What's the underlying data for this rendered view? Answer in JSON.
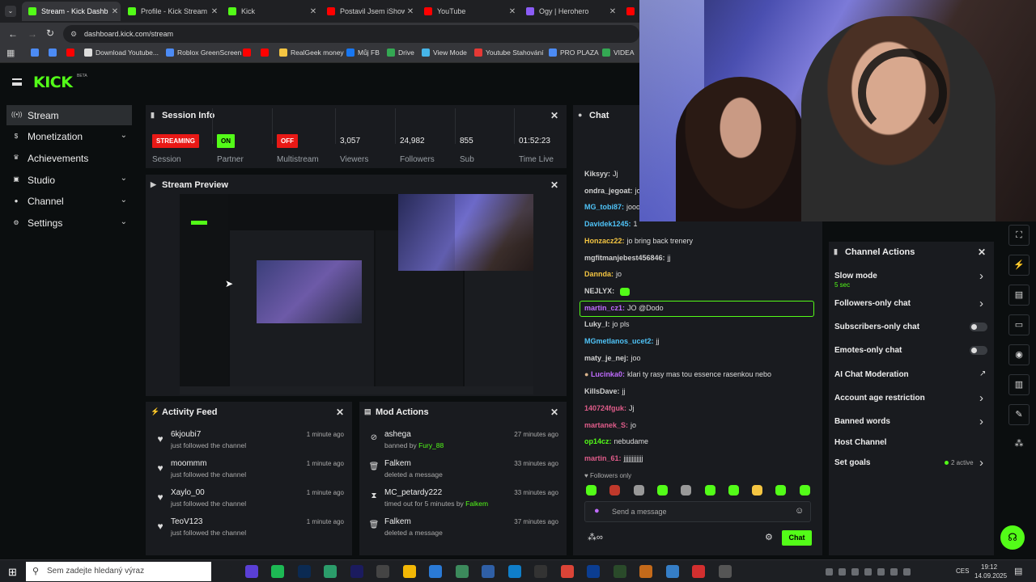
{
  "browser": {
    "tabs": [
      {
        "label": "Stream - Kick Dashb",
        "color": "#53fc18",
        "active": true
      },
      {
        "label": "Profile - Kick Stream",
        "color": "#53fc18"
      },
      {
        "label": "Kick",
        "color": "#53fc18"
      },
      {
        "label": "Postavil Jsem iShowS",
        "color": "#ff0000"
      },
      {
        "label": "YouTube",
        "color": "#ff0000"
      },
      {
        "label": "Ogy | Herohero",
        "color": "#8b5cf6"
      },
      {
        "label": "G",
        "color": "#ff0000"
      }
    ],
    "url": "dashboard.kick.com/stream",
    "bookmarks": [
      {
        "label": "",
        "color": "#4c8bf5"
      },
      {
        "label": "",
        "color": "#4c8bf5"
      },
      {
        "label": "",
        "color": "#ff0000"
      },
      {
        "label": "Download Youtube...",
        "color": "#ddd"
      },
      {
        "label": "Roblox GreenScreen",
        "color": "#4c8bf5"
      },
      {
        "label": "",
        "color": "#ff0000"
      },
      {
        "label": "",
        "color": "#ff0000"
      },
      {
        "label": "RealGeek money",
        "color": "#f4c542"
      },
      {
        "label": "Můj FB",
        "color": "#1877f2"
      },
      {
        "label": "Drive",
        "color": "#34a853"
      },
      {
        "label": "View Mode",
        "color": "#46b5e8"
      },
      {
        "label": "Youtube Stahování",
        "color": "#e53935"
      },
      {
        "label": "PRO PLAZA",
        "color": "#4c8bf5"
      },
      {
        "label": "VIDEA",
        "color": "#34a853"
      }
    ]
  },
  "brand": {
    "logo": "KICK",
    "beta": "BETA",
    "accent": "#53fc18"
  },
  "sidebar": {
    "items": [
      {
        "label": "Stream",
        "icon": "broadcast-icon",
        "glyph": "((•))",
        "active": true,
        "chevron": false
      },
      {
        "label": "Monetization",
        "icon": "dollar-icon",
        "glyph": "$",
        "chevron": true
      },
      {
        "label": "Achievements",
        "icon": "trophy-icon",
        "glyph": "♛",
        "chevron": false
      },
      {
        "label": "Studio",
        "icon": "camera-icon",
        "glyph": "▣",
        "chevron": true
      },
      {
        "label": "Channel",
        "icon": "user-icon",
        "glyph": "●",
        "chevron": true
      },
      {
        "label": "Settings",
        "icon": "gear-icon",
        "glyph": "⚙",
        "chevron": true
      }
    ]
  },
  "session": {
    "title": "Session Info",
    "stats": [
      {
        "badge": "STREAMING",
        "badge_bg": "#e91916",
        "label": "Session"
      },
      {
        "badge": "ON",
        "badge_bg": "#53fc18",
        "label": "Partner"
      },
      {
        "badge": "OFF",
        "badge_bg": "#e91916",
        "label": "Multistream"
      },
      {
        "value": "3,057",
        "label": "Viewers"
      },
      {
        "value": "24,982",
        "label": "Followers"
      },
      {
        "value": "855",
        "label": "Sub"
      },
      {
        "value": "01:52:23",
        "label": "Time Live"
      }
    ]
  },
  "preview": {
    "title": "Stream Preview"
  },
  "activity": {
    "title": "Activity Feed",
    "items": [
      {
        "name": "6kjoubi7",
        "desc": "just followed the channel",
        "time": "1 minute ago"
      },
      {
        "name": "moommm",
        "desc": "just followed the channel",
        "time": "1 minute ago"
      },
      {
        "name": "Xaylo_00",
        "desc": "just followed the channel",
        "time": "1 minute ago"
      },
      {
        "name": "TeoV123",
        "desc": "just followed the channel",
        "time": "1 minute ago"
      }
    ]
  },
  "mod": {
    "title": "Mod Actions",
    "items": [
      {
        "name": "ashega",
        "icon": "ban-icon",
        "glyph": "⊘",
        "desc": "banned by ",
        "by": "Fury_88",
        "time": "27 minutes ago"
      },
      {
        "name": "Falkem",
        "icon": "trash-icon",
        "glyph": "🗑",
        "desc": "deleted a message",
        "by": "",
        "time": "33 minutes ago"
      },
      {
        "name": "MC_petardy222",
        "icon": "hourglass-icon",
        "glyph": "⧗",
        "desc": "timed out for 5 minutes by ",
        "by": "Falkem",
        "time": "33 minutes ago"
      },
      {
        "name": "Falkem",
        "icon": "trash-icon",
        "glyph": "🗑",
        "desc": "deleted a message",
        "by": "",
        "time": "37 minutes ago"
      }
    ]
  },
  "chat": {
    "title": "Chat",
    "messages": [
      {
        "user": "Kiksyy:",
        "color": "#d0d0d0",
        "text": "Jj"
      },
      {
        "user": "ondra_jegoat:",
        "color": "#d0d0d0",
        "text": "jo"
      },
      {
        "user": "MG_tobi87:",
        "color": "#4fc3f7",
        "text": "jooo"
      },
      {
        "user": "Davidek1245:",
        "color": "#4fc3f7",
        "text": "1"
      },
      {
        "user": "Honzacz22:",
        "color": "#f4c542",
        "text": "jo bring back trenery"
      },
      {
        "user": "mgfitmanjebest456846:",
        "color": "#d0d0d0",
        "text": "jj"
      },
      {
        "user": "Dannda:",
        "color": "#f4c542",
        "text": "jo"
      },
      {
        "user": "NEJLYX:",
        "color": "#d0d0d0",
        "text": ""
      },
      {
        "user": "martin_cz1:",
        "color": "#c06bff",
        "text": "JO @Dodo",
        "highlight": true
      },
      {
        "user": "Luky_I:",
        "color": "#d0d0d0",
        "text": "jo pls"
      },
      {
        "user": "MGmetlanos_ucet2:",
        "color": "#4fc3f7",
        "text": "jj"
      },
      {
        "user": "maty_je_nej:",
        "color": "#d0d0d0",
        "text": "joo"
      },
      {
        "user": "Lucinka0:",
        "color": "#c06bff",
        "text": "klari ty rasy mas tou essence rasenkou nebo"
      },
      {
        "user": "KillsDave:",
        "color": "#d0d0d0",
        "text": "jj"
      },
      {
        "user": "140724fguk:",
        "color": "#e05c8a",
        "text": "Jj"
      },
      {
        "user": "martanek_S:",
        "color": "#e05c8a",
        "text": "jo"
      },
      {
        "user": "op14cz:",
        "color": "#53fc18",
        "text": "nebudame"
      },
      {
        "user": "martin_61:",
        "color": "#e05c8a",
        "text": "jjjjjjjjjjjj"
      }
    ],
    "mode": "Followers only",
    "placeholder": "Send a message",
    "send_label": "Chat"
  },
  "channel_actions": {
    "title": "Channel Actions",
    "items": [
      {
        "label": "Slow mode",
        "sub": "5 sec",
        "control": "chevron"
      },
      {
        "label": "Followers-only chat",
        "control": "chevron"
      },
      {
        "label": "Subscribers-only chat",
        "control": "toggle"
      },
      {
        "label": "Emotes-only chat",
        "control": "toggle"
      },
      {
        "label": "AI Chat Moderation",
        "control": "external"
      },
      {
        "label": "Account age restriction",
        "control": "chevron"
      },
      {
        "label": "Banned words",
        "control": "chevron"
      },
      {
        "label": "Host Channel",
        "control": "none"
      },
      {
        "label": "Set goals",
        "extra": "2 active",
        "control": "chevron"
      }
    ]
  },
  "taskbar": {
    "search_placeholder": "Sem zadejte hledaný výraz",
    "lang": "CES",
    "time": "19:12",
    "date": "14.09.2025"
  }
}
